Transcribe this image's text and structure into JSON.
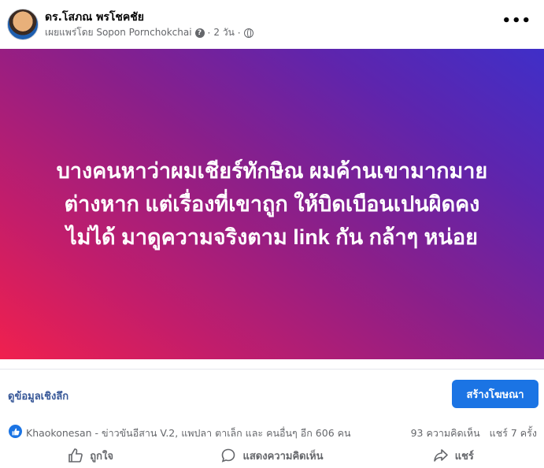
{
  "post": {
    "author": "ดร.โสภณ พรโชคชัย",
    "published_by": "เผยแพร่โดย Sopon Pornchokchai",
    "time": "2 วัน",
    "separator": "·",
    "more_label": "•••"
  },
  "banner": {
    "lines": [
      "บางคนหาว่าผมเชียร์ทักษิณ ผมค้านเขามากมาย",
      "ต่างหาก แต่เรื่องที่เขาถูก ให้บิดเบือนเปนผิดคง",
      "ไม่ได้ มาดูความจริงตาม link กัน กล้าๆ หน่อย"
    ],
    "gradient_colors": [
      "#f0204e",
      "#8a1f8a",
      "#3f2fc8"
    ]
  },
  "link": {
    "title": "ดูข้อมูลเชิงลึก",
    "cta_label": "สร้างโฆษณา",
    "cta_color": "#1b74e4"
  },
  "stats": {
    "reactors": "Khaokonesan - ข่าวขันอีสาน V.2, แพปลา ตาเล็ก และ คนอื่นๆ อีก 606 คน",
    "comments": "93 ความคิดเห็น",
    "shares": "แชร์ 7 ครั้ง"
  },
  "actions": {
    "like": "ถูกใจ",
    "comment": "แสดงความคิดเห็น",
    "share": "แชร์"
  },
  "icons": {
    "reaction": "thumbs-up-icon",
    "audience": "globe-icon",
    "info": "question-icon"
  }
}
